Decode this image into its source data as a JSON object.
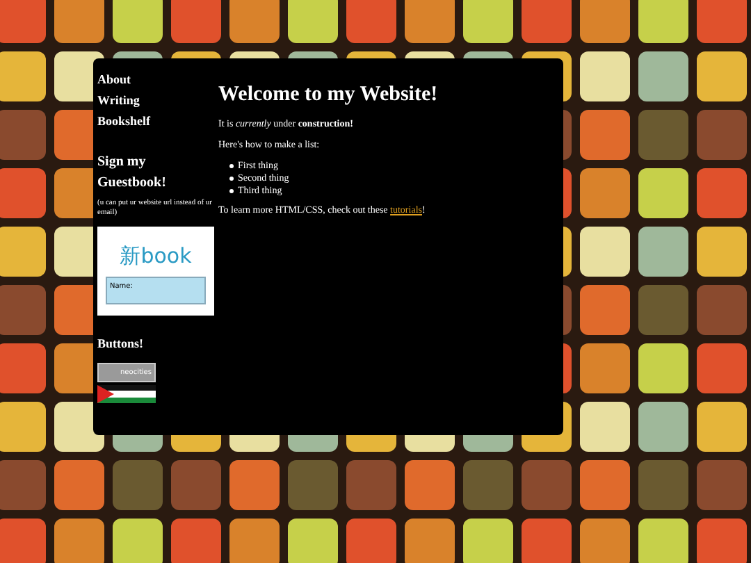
{
  "nav": [
    {
      "label": "About"
    },
    {
      "label": "Writing"
    },
    {
      "label": "Bookshelf"
    }
  ],
  "guestbook": {
    "title": "Sign my Guestbook!",
    "note": "(u can put ur website url instead of ur email)",
    "logo": "新book",
    "field_label": "Name:"
  },
  "buttons_section": {
    "title": "Buttons!",
    "badges": [
      {
        "kind": "neocities",
        "text": "neocities"
      },
      {
        "kind": "flag"
      }
    ]
  },
  "main": {
    "title": "Welcome to my Website!",
    "intro": "It is *currently* under **construction!**",
    "list_intro": "Here's how to make a list:",
    "list": [
      "First thing",
      "Second thing",
      "Third thing"
    ],
    "outro_before": "To learn more HTML/CSS, check out these",
    "outro_link": "tutorials",
    "outro_after": "!"
  }
}
